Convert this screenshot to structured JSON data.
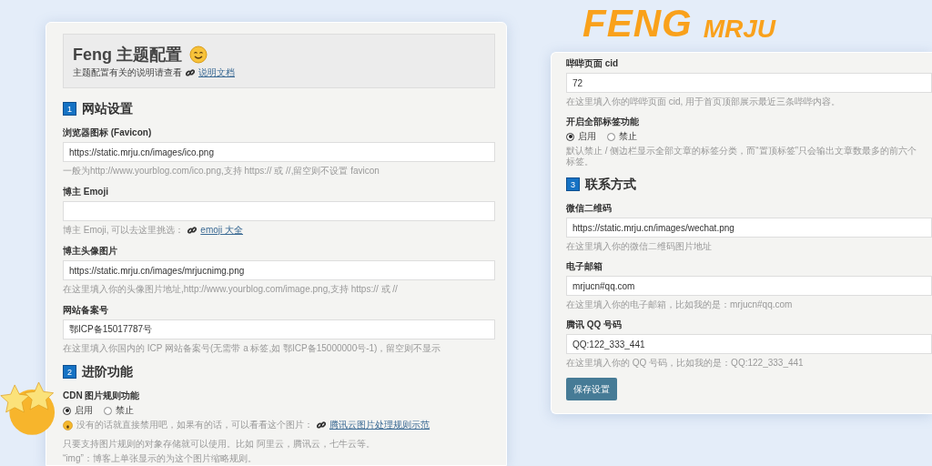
{
  "left_panel": {
    "header": {
      "title": "Feng 主题配置",
      "subtitle": "主题配置有关的说明请查看",
      "link": "说明文档"
    },
    "items": [
      {
        "kind": "heading",
        "number": "1",
        "title": "网站设置"
      },
      {
        "kind": "field",
        "label": "浏览器图标 (Favicon)",
        "value": "https://static.mrju.cn/images/ico.png",
        "hint": "一般为http://www.yourblog.com/ico.png,支持 https:// 或 //,留空则不设置 favicon"
      },
      {
        "kind": "field",
        "label": "博主 Emoji",
        "hint": "博主 Emoji, 可以去这里挑选：",
        "hint_link": "emoji 大全"
      },
      {
        "kind": "field",
        "label": "博主头像图片",
        "value": "https://static.mrju.cn/images/mrjucnimg.png",
        "hint": "在这里填入你的头像图片地址,http://www.yourblog.com/image.png,支持 https:// 或 //"
      },
      {
        "kind": "field",
        "label": "网站备案号",
        "value": "鄂ICP备15017787号",
        "hint": "在这里填入你国内的 ICP 网站备案号(无需带 a 标签,如 鄂ICP备15000000号-1)，留空则不显示"
      },
      {
        "kind": "heading",
        "number": "2",
        "title": "进阶功能"
      },
      {
        "kind": "radios",
        "label": "CDN 图片规则功能",
        "options": [
          {
            "label": "启用",
            "selected": true
          },
          {
            "label": "禁止",
            "selected": false
          }
        ],
        "hint_emoji": true,
        "hint": "没有的话就直接禁用吧，如果有的话，可以看看这个图片：",
        "hint_link": "腾讯云图片处理规则示范"
      },
      {
        "kind": "note",
        "text": "只要支持图片规则的对象存储就可以使用。比如 阿里云，腾讯云，七牛云等。"
      },
      {
        "kind": "note",
        "text": "“img”：博客上单张显示的为这个图片缩略规则。"
      }
    ]
  },
  "right_panel": {
    "items": [
      {
        "kind": "field",
        "label": "哔哔页面 cid",
        "value": "72",
        "hint": "在这里填入你的哔哔页面 cid, 用于首页顶部展示最近三条哔哔内容。"
      },
      {
        "kind": "radios",
        "label": "开启全部标签功能",
        "options": [
          {
            "label": "启用",
            "selected": true
          },
          {
            "label": "禁止",
            "selected": false
          }
        ],
        "hint": "默认禁止 / 侧边栏显示全部文章的标签分类，而“置顶标签”只会输出文章数最多的前六个标签。"
      },
      {
        "kind": "heading",
        "number": "3",
        "title": "联系方式"
      },
      {
        "kind": "field",
        "label": "微信二维码",
        "value": "https://static.mrju.cn/images/wechat.png",
        "hint": "在这里填入你的微信二维码图片地址"
      },
      {
        "kind": "field",
        "label": "电子邮箱",
        "value": "mrjucn#qq.com",
        "hint": "在这里填入你的电子邮箱，比如我的是：mrjucn#qq.com"
      },
      {
        "kind": "field",
        "label": "腾讯 QQ 号码",
        "value": "QQ:122_333_441",
        "hint": "在这里填入你的 QQ 号码，比如我的是：QQ:122_333_441"
      }
    ],
    "save_button": "保存设置"
  },
  "overlay": {
    "logo_line_1": "FENG",
    "logo_line_2": "MRJU"
  }
}
